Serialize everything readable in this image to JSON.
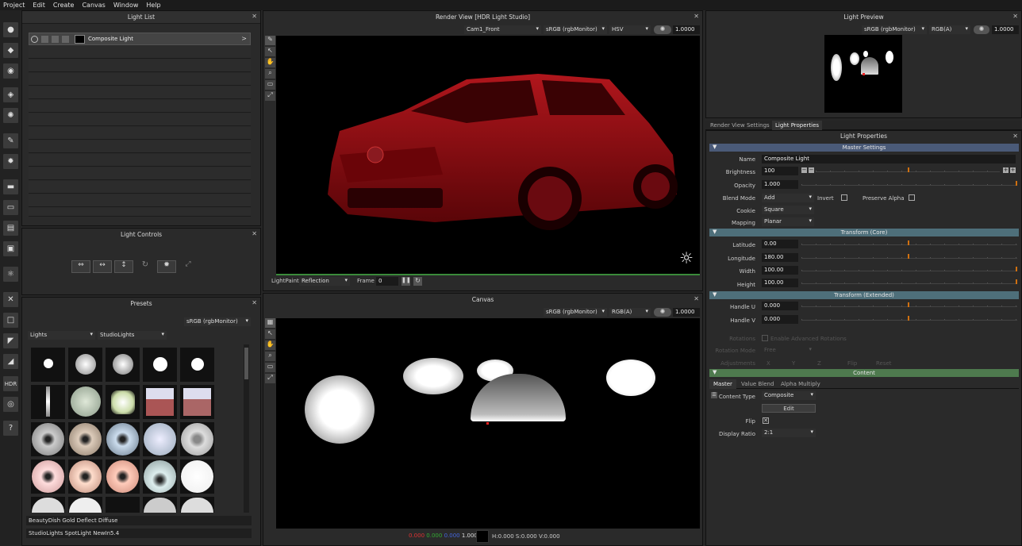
{
  "menu": [
    "Project",
    "Edit",
    "Create",
    "Canvas",
    "Window",
    "Help"
  ],
  "light_list": {
    "title": "Light List",
    "item_label": "Composite Light"
  },
  "light_controls": {
    "title": "Light Controls"
  },
  "presets": {
    "title": "Presets",
    "color_space": "sRGB (rgbMonitor)",
    "category": "Lights",
    "library": "StudioLights",
    "status_lines": [
      "BeautyDish Gold Deflect Diffuse",
      "StudioLights SpotLight NewIn5.4"
    ]
  },
  "render_view": {
    "title": "Render View [HDR Light Studio]",
    "camera": "Cam1_Front",
    "color_space": "sRGB (rgbMonitor)",
    "mode": "HSV",
    "exposure": "1.0000",
    "lightpaint_label": "LightPaint",
    "lightpaint_mode": "Reflection",
    "frame_label": "Frame",
    "frame_value": "0"
  },
  "canvas": {
    "title": "Canvas",
    "color_space": "sRGB (rgbMonitor)",
    "channels": "RGB(A)",
    "exposure": "1.0000",
    "pixel_r": "0.000",
    "pixel_g": "0.000",
    "pixel_b": "0.000",
    "pixel_a": "1.000",
    "hsv": "H:0.000 S:0.000 V:0.000"
  },
  "light_preview": {
    "title": "Light Preview",
    "color_space": "sRGB (rgbMonitor)",
    "channels": "RGB(A)",
    "exposure": "1.0000"
  },
  "tabs": [
    "Render View Settings",
    "Light Properties"
  ],
  "light_properties": {
    "title": "Light Properties",
    "master_settings": "Master Settings",
    "name_label": "Name",
    "name_value": "Composite Light",
    "brightness_label": "Brightness",
    "brightness_value": "100",
    "opacity_label": "Opacity",
    "opacity_value": "1.000",
    "blend_mode_label": "Blend Mode",
    "blend_mode_value": "Add",
    "invert_label": "Invert",
    "preserve_alpha_label": "Preserve Alpha",
    "cookie_label": "Cookie",
    "cookie_value": "Square",
    "mapping_label": "Mapping",
    "mapping_value": "Planar",
    "transform_core": "Transform (Core)",
    "latitude_label": "Latitude",
    "latitude_value": "0.00",
    "longitude_label": "Longitude",
    "longitude_value": "180.00",
    "width_label": "Width",
    "width_value": "100.00",
    "height_label": "Height",
    "height_value": "100.00",
    "transform_extended": "Transform (Extended)",
    "handle_u_label": "Handle U",
    "handle_u_value": "0.000",
    "handle_v_label": "Handle V",
    "handle_v_value": "0.000",
    "rotations_label": "Rotations",
    "rotations_check": "Enable Advanced Rotations",
    "rotation_mode_label": "Rotation Mode",
    "rotation_mode_value": "Free",
    "adjustments_label": "Adjustments",
    "adj_x": "X",
    "adj_y": "Y",
    "adj_z": "Z",
    "flip_btn": "Flip",
    "reset_btn": "Reset",
    "content": "Content",
    "content_tabs": [
      "Master",
      "Value Blend",
      "Alpha Multiply"
    ],
    "content_type_label": "Content Type",
    "content_type_value": "Composite",
    "edit_btn": "Edit",
    "flip_label": "Flip",
    "display_ratio_label": "Display Ratio",
    "display_ratio_value": "2:1"
  },
  "colors": {
    "section_blue": "#4a5a78",
    "section_teal": "#4e6f7a",
    "section_green": "#4e7a4e",
    "car_red": "#8a0a10",
    "accent_orange": "#d07010"
  }
}
